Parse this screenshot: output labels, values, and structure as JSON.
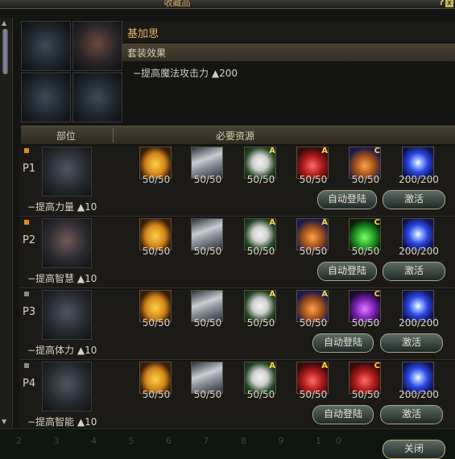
{
  "window": {
    "title": "收藏品",
    "help_label": "?",
    "close_x_label": "x"
  },
  "set": {
    "name": "基加思",
    "effect_title": "套装效果",
    "effect_text": "−提高魔法攻击力 ▲200"
  },
  "table": {
    "col_part": "部位",
    "col_resources": "必要资源"
  },
  "rows": [
    {
      "code": "P1",
      "stat": "−提高力量 ▲10",
      "slots": [
        {
          "icon": "gold-ore-icon",
          "count": "50/50",
          "badge": ""
        },
        {
          "icon": "metal-plate-icon",
          "count": "50/50",
          "badge": ""
        },
        {
          "icon": "scroll-card-icon",
          "count": "50/50",
          "badge": "A"
        },
        {
          "icon": "red-potion-icon",
          "count": "50/50",
          "badge": "A"
        },
        {
          "icon": "orange-potion-icon",
          "count": "50/50",
          "badge": "C"
        },
        {
          "icon": "blue-swirl-icon",
          "count": "200/200",
          "badge": ""
        }
      ],
      "auto_label": "自动登陆",
      "activate_label": "激活"
    },
    {
      "code": "P2",
      "stat": "−提高智慧 ▲10",
      "slots": [
        {
          "icon": "gold-ore-icon",
          "count": "50/50",
          "badge": ""
        },
        {
          "icon": "metal-plate-icon",
          "count": "50/50",
          "badge": ""
        },
        {
          "icon": "scroll-card-icon",
          "count": "50/50",
          "badge": "A"
        },
        {
          "icon": "orange-potion-icon",
          "count": "50/50",
          "badge": "A"
        },
        {
          "icon": "green-potion-icon",
          "count": "50/50",
          "badge": "C"
        },
        {
          "icon": "blue-swirl-icon",
          "count": "200/200",
          "badge": ""
        }
      ],
      "auto_label": "自动登陆",
      "activate_label": "激活"
    },
    {
      "code": "P3",
      "stat": "−提高体力 ▲10",
      "slots": [
        {
          "icon": "gold-ore-icon",
          "count": "50/50",
          "badge": ""
        },
        {
          "icon": "metal-plate-icon",
          "count": "50/50",
          "badge": ""
        },
        {
          "icon": "scroll-card-icon",
          "count": "50/50",
          "badge": "A"
        },
        {
          "icon": "brown-potion-icon",
          "count": "50/50",
          "badge": "A"
        },
        {
          "icon": "purple-potion-icon",
          "count": "50/50",
          "badge": "C"
        },
        {
          "icon": "blue-swirl-icon",
          "count": "200/200",
          "badge": ""
        }
      ],
      "auto_label": "自动登陆",
      "activate_label": "激活"
    },
    {
      "code": "P4",
      "stat": "−提高智能 ▲10",
      "slots": [
        {
          "icon": "gold-ore-icon",
          "count": "50/50",
          "badge": ""
        },
        {
          "icon": "metal-plate-icon",
          "count": "50/50",
          "badge": ""
        },
        {
          "icon": "scroll-card-icon",
          "count": "50/50",
          "badge": "A"
        },
        {
          "icon": "red-potion-icon",
          "count": "50/50",
          "badge": "A"
        },
        {
          "icon": "red-potion-icon",
          "count": "50/50",
          "badge": "C"
        },
        {
          "icon": "blue-swirl-icon",
          "count": "200/200",
          "badge": ""
        }
      ],
      "auto_label": "自动登陆",
      "activate_label": "激活"
    }
  ],
  "footer": {
    "page_numbers": "2 3 4 5 6 7 8 9 10",
    "close_label": "关闭"
  }
}
